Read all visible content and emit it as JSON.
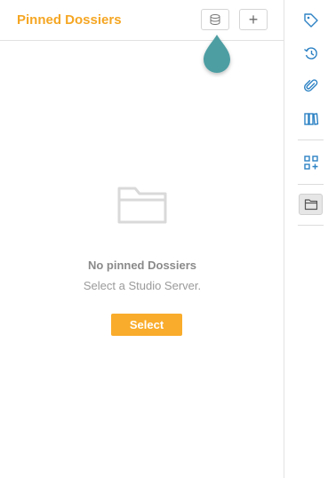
{
  "panel": {
    "title": "Pinned Dossiers",
    "add_button_label": "+",
    "empty_state": {
      "title": "No pinned Dossiers",
      "subtitle": "Select a Studio Server.",
      "select_label": "Select"
    }
  },
  "toolbar": {
    "items": [
      {
        "icon": "tag-icon"
      },
      {
        "icon": "history-icon"
      },
      {
        "icon": "paperclip-icon"
      },
      {
        "icon": "book-icon"
      },
      {
        "icon": "add-widget-icon"
      },
      {
        "icon": "folder-icon",
        "active": true
      }
    ]
  },
  "colors": {
    "accent": "#f5a623",
    "select_button": "#f9ac2b",
    "icon_blue": "#2d82c4",
    "marker_teal": "#4e9ea3"
  }
}
